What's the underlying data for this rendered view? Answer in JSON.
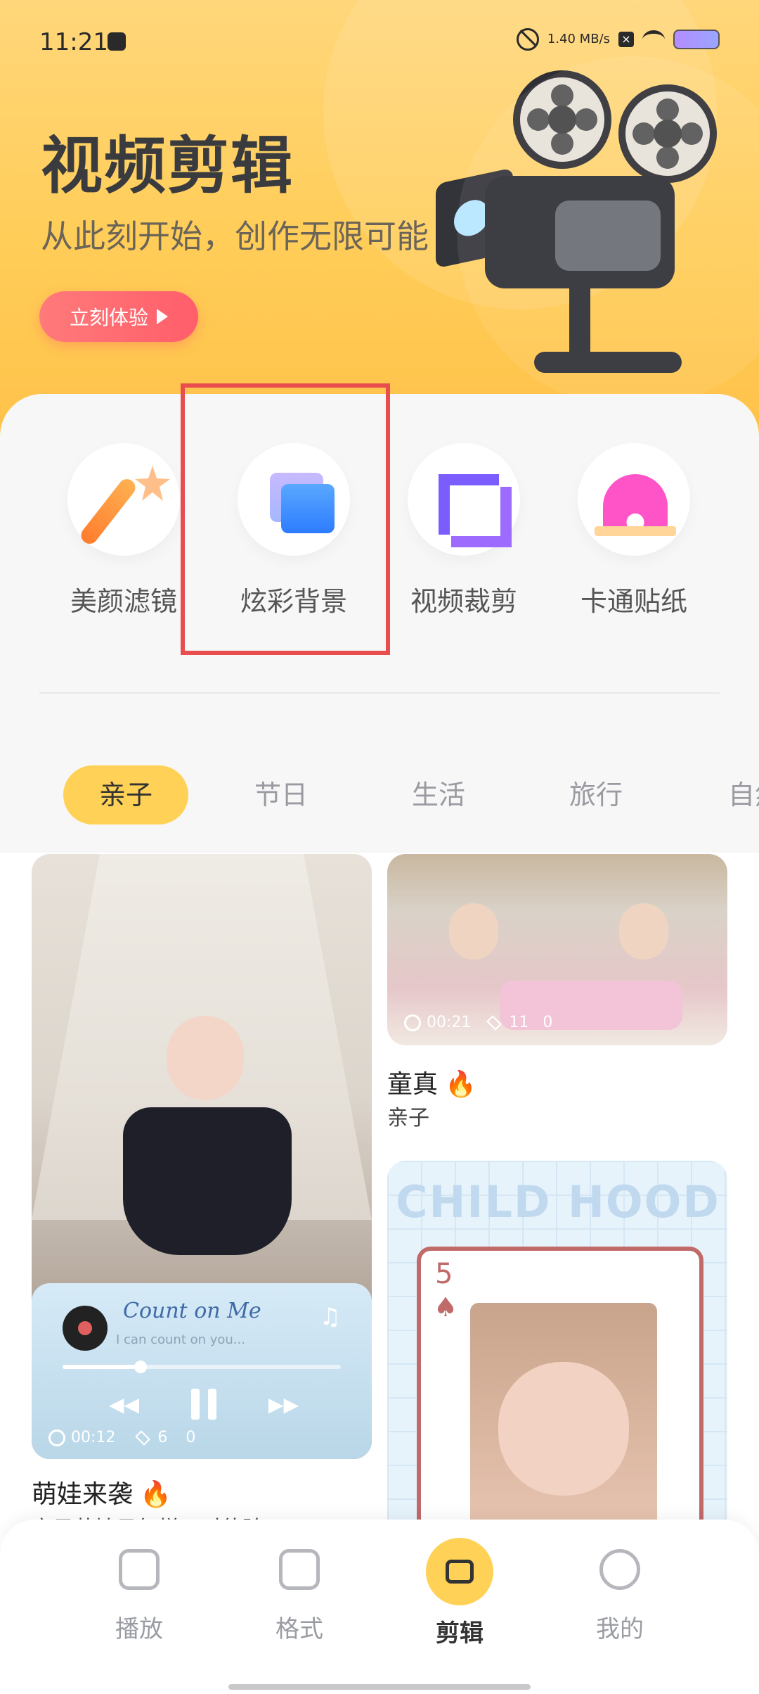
{
  "status_bar": {
    "time": "11:21",
    "speed": "1.40 MB/s"
  },
  "hero": {
    "title": "视频剪辑",
    "subtitle": "从此刻开始，创作无限可能",
    "cta": "立刻体验"
  },
  "tools": [
    {
      "label": "美颜滤镜",
      "icon": "magic-wand-icon"
    },
    {
      "label": "炫彩背景",
      "icon": "image-stack-icon"
    },
    {
      "label": "视频裁剪",
      "icon": "crop-icon"
    },
    {
      "label": "卡通贴纸",
      "icon": "sticker-icon"
    }
  ],
  "categories": [
    "亲子",
    "节日",
    "生活",
    "旅行",
    "自然"
  ],
  "cards": {
    "left": {
      "title": "萌娃来袭",
      "subtitle": "亲子萌娃日复梯，时值验",
      "player": {
        "song": "Count on Me",
        "lyric": "I can count on you...",
        "progress": 0.28,
        "duration": "00:12",
        "layers": "6",
        "count": "0"
      }
    },
    "right_top": {
      "title": "童真",
      "subtitle": "亲子",
      "duration": "00:21",
      "layers": "11",
      "count": "0"
    },
    "right_bottom": {
      "headline": "CHILD HOOD",
      "playing_card_number": "5",
      "suit": "♠"
    }
  },
  "nav": [
    {
      "label": "播放",
      "icon": "play-video-icon",
      "active": false
    },
    {
      "label": "格式",
      "icon": "film-icon",
      "active": false
    },
    {
      "label": "剪辑",
      "icon": "edit-video-icon",
      "active": true
    },
    {
      "label": "我的",
      "icon": "user-icon",
      "active": false
    }
  ],
  "colors": {
    "accent": "#ffd257",
    "cta_red": "#ff5e6a",
    "highlight_border": "#e94e4e"
  }
}
